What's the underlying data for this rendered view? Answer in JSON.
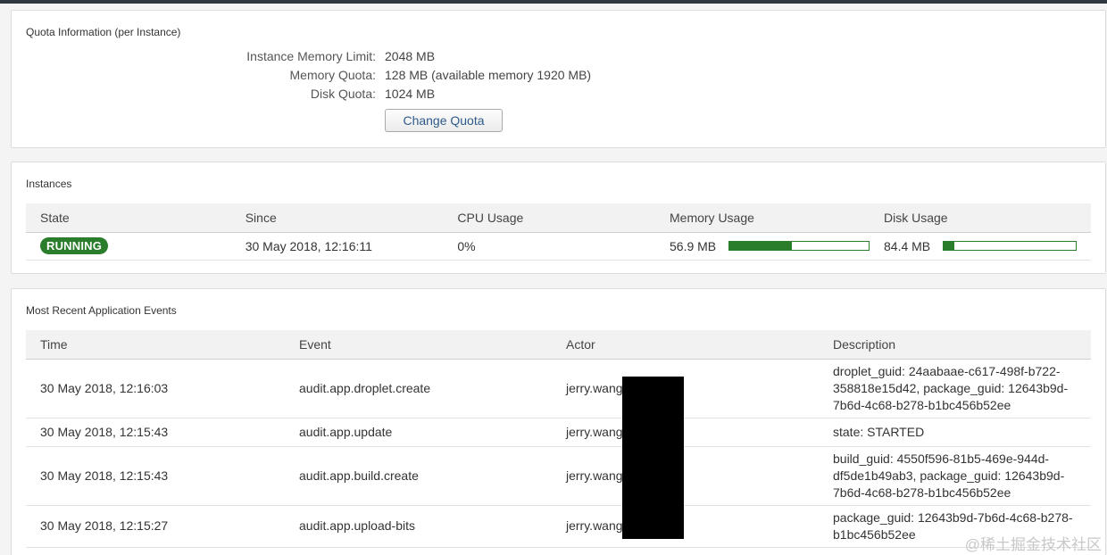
{
  "quota": {
    "title": "Quota Information (per Instance)",
    "rows": [
      {
        "label": "Instance Memory Limit:",
        "value": "2048 MB"
      },
      {
        "label": "Memory Quota:",
        "value": "128 MB (available memory 1920 MB)"
      },
      {
        "label": "Disk Quota:",
        "value": "1024 MB"
      }
    ],
    "change_button": "Change Quota"
  },
  "instances": {
    "title": "Instances",
    "headers": [
      "State",
      "Since",
      "CPU Usage",
      "Memory Usage",
      "Disk Usage"
    ],
    "row": {
      "state": "RUNNING",
      "since": "30 May 2018, 12:16:11",
      "cpu": "0%",
      "memory": "56.9 MB",
      "memory_fraction": 0.45,
      "disk": "84.4 MB",
      "disk_fraction": 0.08
    }
  },
  "events": {
    "title": "Most Recent Application Events",
    "headers": [
      "Time",
      "Event",
      "Actor",
      "Description"
    ],
    "rows": [
      {
        "time": "30 May 2018, 12:16:03",
        "event": "audit.app.droplet.create",
        "actor": "jerry.wang",
        "description": "droplet_guid: 24aabaae-c617-498f-b722-358818e15d42, package_guid: 12643b9d-7b6d-4c68-b278-b1bc456b52ee"
      },
      {
        "time": "30 May 2018, 12:15:43",
        "event": "audit.app.update",
        "actor": "jerry.wang",
        "description": "state: STARTED"
      },
      {
        "time": "30 May 2018, 12:15:43",
        "event": "audit.app.build.create",
        "actor": "jerry.wang",
        "description": "build_guid: 4550f596-81b5-469e-944d-df5de1b49ab3, package_guid: 12643b9d-7b6d-4c68-b278-b1bc456b52ee"
      },
      {
        "time": "30 May 2018, 12:15:27",
        "event": "audit.app.upload-bits",
        "actor": "jerry.wang",
        "description": "package_guid: 12643b9d-7b6d-4c68-b278-b1bc456b52ee"
      }
    ]
  },
  "watermark": "@稀土掘金技术社区",
  "colors": {
    "accent": "#2a7d2a",
    "link": "#2e5a8a",
    "topbar": "#2f3640"
  }
}
